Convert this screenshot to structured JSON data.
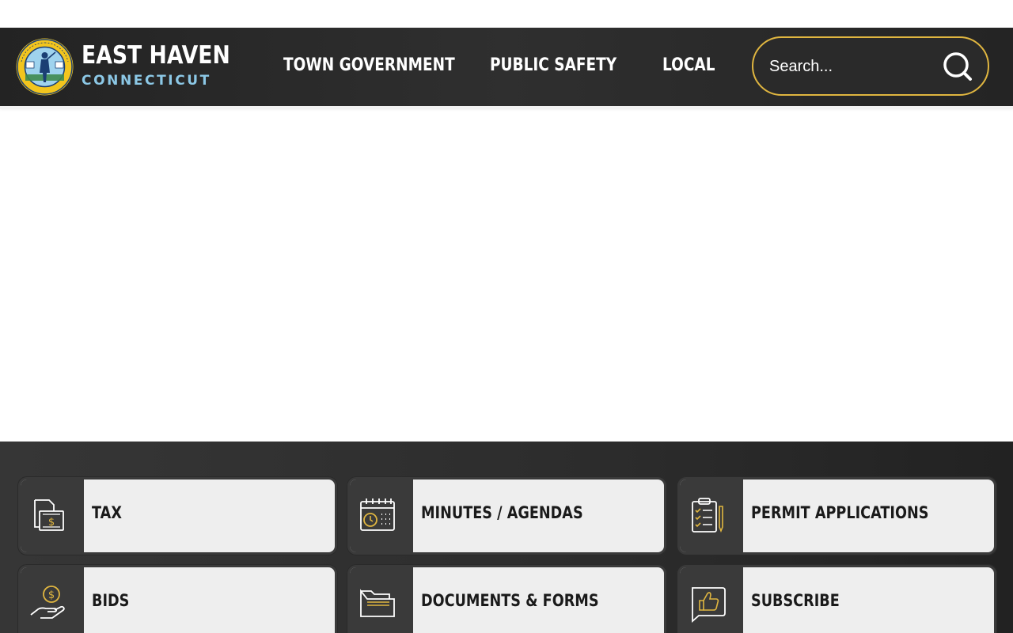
{
  "brand": {
    "title": "EAST HAVEN",
    "subtitle": "CONNECTICUT",
    "seal_text": "TOWN OF EAST HAVEN · CONNECTICUT"
  },
  "nav": {
    "items": [
      {
        "label": "TOWN GOVERNMENT"
      },
      {
        "label": "PUBLIC SAFETY"
      },
      {
        "label": "LOCAL"
      }
    ]
  },
  "search": {
    "placeholder": "Search...",
    "icon": "search-icon"
  },
  "quick_links": [
    {
      "label": "TAX",
      "icon": "tax-bill-icon"
    },
    {
      "label": "MINUTES / AGENDAS",
      "icon": "calendar-clock-icon"
    },
    {
      "label": "PERMIT APPLICATIONS",
      "icon": "clipboard-checklist-icon"
    },
    {
      "label": "BIDS",
      "icon": "hand-coin-icon"
    },
    {
      "label": "DOCUMENTS & FORMS",
      "icon": "folder-icon"
    },
    {
      "label": "SUBSCRIBE",
      "icon": "thumbs-up-icon"
    }
  ],
  "colors": {
    "header_bg": "#2a2a2a",
    "accent_gold": "#e0b640",
    "subtitle_blue": "#8cc8e6",
    "tile_bg": "#eeeeee",
    "tile_icon_bg": "#3a3a3a"
  }
}
